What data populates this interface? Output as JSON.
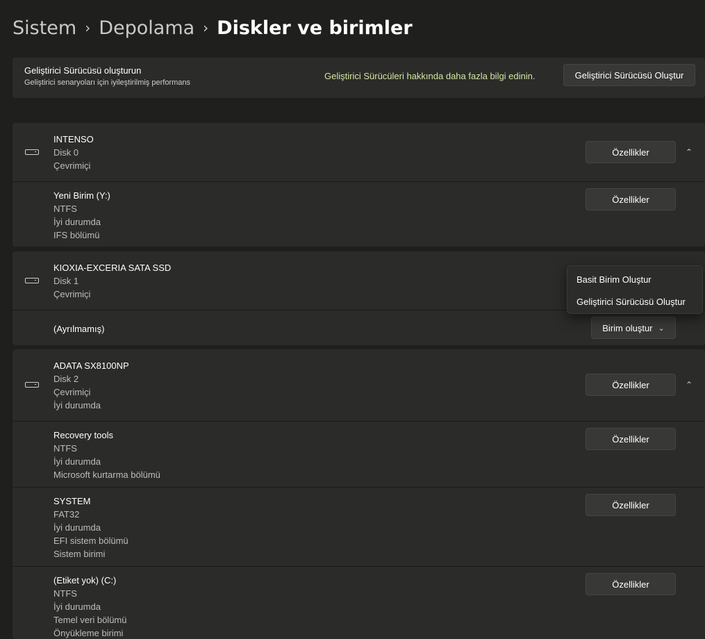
{
  "breadcrumb": {
    "items": [
      "Sistem",
      "Depolama",
      "Diskler ve birimler"
    ],
    "separator": "›"
  },
  "dev_drive": {
    "title": "Geliştirici Sürücüsü oluşturun",
    "subtitle": "Geliştirici senaryoları için iyileştirilmiş performans",
    "link": "Geliştirici Sürücüleri hakkında daha fazla bilgi edinin.",
    "button": "Geliştirici Sürücüsü Oluştur"
  },
  "disks": [
    {
      "name": "INTENSO",
      "lines": [
        "Disk 0",
        "Çevrimiçi"
      ],
      "button": "Özellikler",
      "volumes": [
        {
          "name": "Yeni Birim (Y:)",
          "lines": [
            "NTFS",
            "İyi durumda",
            "IFS bölümü"
          ],
          "button": "Özellikler"
        }
      ]
    },
    {
      "name": "KIOXIA-EXCERIA SATA SSD",
      "lines": [
        "Disk 1",
        "Çevrimiçi"
      ],
      "volumes": [
        {
          "name": "(Ayrılmamış)",
          "button": "Birim oluştur"
        }
      ]
    },
    {
      "name": "ADATA SX8100NP",
      "lines": [
        "Disk 2",
        "Çevrimiçi",
        "İyi durumda"
      ],
      "button": "Özellikler",
      "volumes": [
        {
          "name": "Recovery tools",
          "lines": [
            "NTFS",
            "İyi durumda",
            "Microsoft kurtarma bölümü"
          ],
          "button": "Özellikler"
        },
        {
          "name": "SYSTEM",
          "lines": [
            "FAT32",
            "İyi durumda",
            "EFI sistem bölümü",
            "Sistem birimi"
          ],
          "button": "Özellikler"
        },
        {
          "name": "(Etiket yok) (C:)",
          "lines": [
            "NTFS",
            "İyi durumda",
            "Temel veri bölümü",
            "Önyükleme birimi"
          ],
          "button": "Özellikler"
        }
      ]
    }
  ],
  "create_menu": {
    "items": [
      "Basit Birim Oluştur",
      "Geliştirici Sürücüsü Oluştur"
    ]
  },
  "icons": {
    "disk": "disk-drive-icon",
    "collapse": "chevron-up-icon",
    "dropdown": "chevron-down-icon"
  }
}
